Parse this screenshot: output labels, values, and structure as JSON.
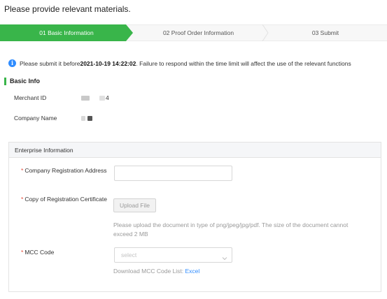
{
  "header": {
    "title": "Please provide relevant materials."
  },
  "steps": [
    {
      "label": "01 Basic Information",
      "active": true
    },
    {
      "label": "02 Proof Order Information",
      "active": false
    },
    {
      "label": "03 Submit",
      "active": false
    }
  ],
  "notice": {
    "icon": "info-icon",
    "prefix": "Please submit it before ",
    "deadline": "2021-10-19 14:22:02",
    "suffix": ". Failure to respond within the time limit will affect the use of the relevant functions"
  },
  "basic_info": {
    "title": "Basic Info",
    "merchant_id_label": "Merchant ID",
    "merchant_id_value_suffix": "4",
    "company_name_label": "Company Name"
  },
  "enterprise": {
    "title": "Enterprise Information",
    "address_label": "Company Registration Address",
    "address_value": "",
    "certificate_label": "Copy of Registration Certificate",
    "upload_button": "Upload File",
    "upload_help": "Please upload the document in type of png/jpeg/jpg/pdf. The size of the document cannot exceed 2 MB",
    "mcc_label": "MCC Code",
    "mcc_placeholder": "select",
    "download_text": "Download MCC Code List: ",
    "download_link": "Excel",
    "required_mark": "*"
  },
  "colors": {
    "accent": "#39b54a",
    "link": "#2f8cff",
    "required": "#e64c3c"
  }
}
